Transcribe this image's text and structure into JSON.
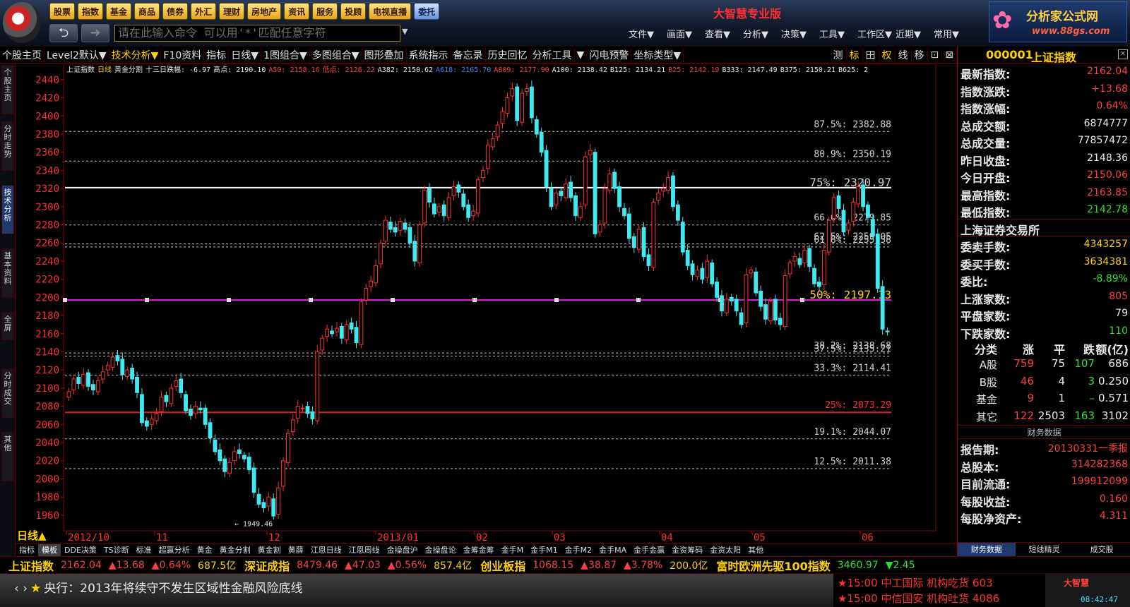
{
  "app": {
    "title": "大智慧专业版",
    "brand_name": "分析家公式网",
    "brand_url": "www.88gs.com"
  },
  "mainnav": [
    "股票",
    "指数",
    "基金",
    "商品",
    "债券",
    "外汇",
    "理财",
    "房地产",
    "资讯",
    "服务",
    "投顾",
    "电视直播",
    "委托"
  ],
  "command": {
    "placeholder": "请在此输入命令  可以用'*'匹配任意字符"
  },
  "menus": [
    "文件▼",
    "画面▼",
    "查看▼",
    "分析▼",
    "决策▼",
    "工具▼",
    "工作区▼",
    "近期▼",
    "常用▼"
  ],
  "tabs": [
    "个股主页",
    "Level2默认▼",
    "技术分析▼",
    "F10资料",
    "指标",
    "日线▼",
    "1图组合▼",
    "多图组合▼",
    "图形叠加",
    "系统指示",
    "备忘录",
    "历史回忆",
    "分析工具",
    "▼",
    "闪电预警",
    "坐标类型▼"
  ],
  "toolicons": [
    "测",
    "标",
    "田",
    "权",
    "线",
    "移",
    "⊡",
    "⊠"
  ],
  "sidebar": [
    "个股主页",
    "分时走势",
    "技术分析",
    "基本资料",
    "全屏",
    "分时成交",
    "其他"
  ],
  "chart": {
    "header": {
      "name": "上证指数",
      "period": "日线",
      "tool": "黄金分割",
      "label13": "十三日跌幅: -6.97",
      "high": "高点: 2190.10",
      "a50": "A50: 2158.16",
      "low": "低点: 2126.22",
      "a382": "A382: 2150.62",
      "a618": "A618: 2165.70",
      "a809": "A809: 2177.90",
      "a100": "A100: 2138.42",
      "b125": "B125: 2134.21",
      "b25": "B25: 2142.19",
      "b333": "B333: 2147.49",
      "b375": "B375: 2150.21",
      "b625": "B625: 2"
    },
    "period_label": "日线▲",
    "low_marker": "← 1949.46"
  },
  "chart_data": {
    "type": "candlestick",
    "title": "上证指数 日线",
    "ylim": [
      1949,
      2450
    ],
    "y_ticks": [
      1960,
      1980,
      2000,
      2020,
      2040,
      2060,
      2080,
      2100,
      2120,
      2140,
      2160,
      2180,
      2200,
      2220,
      2240,
      2260,
      2280,
      2300,
      2320,
      2340,
      2360,
      2380,
      2400,
      2420,
      2440
    ],
    "x_ticks": [
      "2012/10",
      "11",
      "12",
      "2013/01",
      "02",
      "03",
      "04",
      "05",
      "06"
    ],
    "fib_levels": [
      {
        "label": "87.5%: 2382.88",
        "value": 2382.88,
        "color": "#c0c0c0"
      },
      {
        "label": "80.9%: 2350.19",
        "value": 2350.19,
        "color": "#c0c0c0"
      },
      {
        "label": "75%: 2320.97",
        "value": 2320.97,
        "color": "#ffffff"
      },
      {
        "label": "66.6%: 2279.85",
        "value": 2279.85,
        "color": "#c0c0c0"
      },
      {
        "label": "62.5%: 2259.05",
        "value": 2259.05,
        "color": "#c0c0c0"
      },
      {
        "label": "61.8%: 2255.58",
        "value": 2255.58,
        "color": "#c0c0c0"
      },
      {
        "label": "50%: 2197.13",
        "value": 2197.13,
        "color": "#d020d0"
      },
      {
        "label": "38.2%: 2138.68",
        "value": 2138.68,
        "color": "#c0c0c0"
      },
      {
        "label": "37.5%: 2135.21",
        "value": 2135.21,
        "color": "#c0c0c0"
      },
      {
        "label": "33.3%: 2114.41",
        "value": 2114.41,
        "color": "#c0c0c0"
      },
      {
        "label": "25%: 2073.29",
        "value": 2073.29,
        "color": "#e02020"
      },
      {
        "label": "19.1%: 2044.07",
        "value": 2044.07,
        "color": "#c0c0c0"
      },
      {
        "label": "12.5%: 2011.38",
        "value": 2011.38,
        "color": "#c0c0c0"
      }
    ],
    "candles_close": [
      2096,
      2110,
      2105,
      2115,
      2102,
      2098,
      2108,
      2118,
      2125,
      2134,
      2130,
      2115,
      2120,
      2110,
      2095,
      2062,
      2058,
      2066,
      2072,
      2090,
      2085,
      2100,
      2108,
      2095,
      2075,
      2070,
      2080,
      2076,
      2060,
      2045,
      2030,
      2020,
      2008,
      2018,
      2030,
      2028,
      2022,
      2010,
      1985,
      1972,
      1968,
      1980,
      1959,
      1990,
      2020,
      2050,
      2065,
      2080,
      2078,
      2072,
      2066,
      2140,
      2155,
      2165,
      2160,
      2166,
      2155,
      2170,
      2165,
      2150,
      2195,
      2210,
      2218,
      2235,
      2260,
      2285,
      2275,
      2272,
      2284,
      2275,
      2260,
      2240,
      2280,
      2318,
      2305,
      2292,
      2300,
      2290,
      2310,
      2322,
      2316,
      2300,
      2288,
      2295,
      2330,
      2340,
      2368,
      2375,
      2390,
      2405,
      2420,
      2430,
      2395,
      2425,
      2430,
      2398,
      2380,
      2360,
      2322,
      2300,
      2315,
      2312,
      2325,
      2310,
      2290,
      2300,
      2355,
      2362,
      2270,
      2280,
      2320,
      2336,
      2320,
      2300,
      2290,
      2265,
      2255,
      2275,
      2245,
      2235,
      2305,
      2315,
      2320,
      2332,
      2300,
      2285,
      2250,
      2235,
      2225,
      2230,
      2220,
      2240,
      2215,
      2200,
      2185,
      2198,
      2196,
      2185,
      2170,
      2225,
      2230,
      2205,
      2190,
      2176,
      2196,
      2175,
      2170,
      2224,
      2238,
      2245,
      2236,
      2252,
      2234,
      2215,
      2212,
      2252,
      2285,
      2310,
      2298,
      2272,
      2282,
      2305,
      2322,
      2300,
      2288,
      2268,
      2210,
      2165,
      2162
    ]
  },
  "quote": {
    "code": "000001",
    "name": "上证指数",
    "rows1": [
      {
        "k": "最新指数:",
        "v": "2162.04",
        "c": "red"
      },
      {
        "k": "指数涨跌:",
        "v": "+13.68",
        "c": "red"
      },
      {
        "k": "指数涨幅:",
        "v": "0.64%",
        "c": "red"
      },
      {
        "k": "总成交额:",
        "v": "6874777",
        "c": "white"
      },
      {
        "k": "总成交量:",
        "v": "77857472",
        "c": "white"
      },
      {
        "k": "昨日收盘:",
        "v": "2148.36",
        "c": "white"
      },
      {
        "k": "今日开盘:",
        "v": "2150.06",
        "c": "red"
      },
      {
        "k": "最高指数:",
        "v": "2163.85",
        "c": "red"
      },
      {
        "k": "最低指数:",
        "v": "2142.78",
        "c": "green"
      }
    ],
    "exchange": "上海证券交易所",
    "rows2": [
      {
        "k": "委卖手数:",
        "v": "4343257",
        "c": "yellow"
      },
      {
        "k": "委买手数:",
        "v": "3634381",
        "c": "yellow"
      },
      {
        "k": "  委比:",
        "v": "-8.89%",
        "c": "green"
      },
      {
        "k": "上涨家数:",
        "v": "805",
        "c": "red"
      },
      {
        "k": "平盘家数:",
        "v": "79",
        "c": "white"
      },
      {
        "k": "下跌家数:",
        "v": "110",
        "c": "green"
      }
    ],
    "sector_head": [
      "分类",
      "涨",
      "平",
      "跌",
      "额(亿)"
    ],
    "sectors": [
      {
        "name": "A股",
        "up": "759",
        "flat": "75",
        "down": "107",
        "amt": "686"
      },
      {
        "name": "B股",
        "up": "46",
        "flat": "4",
        "down": "3",
        "amt": "0.250"
      },
      {
        "name": "基金",
        "up": "9",
        "flat": "1",
        "down": "–",
        "amt": "0.571"
      },
      {
        "name": "其它",
        "up": "122",
        "flat": "2503",
        "down": "163",
        "amt": "3102"
      }
    ],
    "fin_header": "财务数据",
    "fin": [
      {
        "k": "报告期:",
        "v": "20130331一季报",
        "c": "red"
      },
      {
        "k": "总股本:",
        "v": "314282368",
        "c": "red"
      },
      {
        "k": "目前流通:",
        "v": "199912099",
        "c": "red"
      },
      {
        "k": "每股收益:",
        "v": "0.160",
        "c": "red"
      },
      {
        "k": "每股净资产:",
        "v": "4.311",
        "c": "red"
      }
    ],
    "bottom_tabs": [
      "财务数据",
      "短线精灵",
      "成交股"
    ]
  },
  "bottom_tabs": [
    "指标",
    "模板",
    "DDE决策",
    "TS诊断",
    "标准",
    "超赢分析",
    "黄金",
    "黄金分割",
    "黄金割",
    "黄薛",
    "江恩日线",
    "江恩周线",
    "金操盘沪",
    "金操盘论",
    "金筹金筹",
    "金手M",
    "金手M1",
    "金手M2",
    "金手MA",
    "金手金赢",
    "金资筹码",
    "金资太阳",
    "其他"
  ],
  "ticker": [
    {
      "name": "上证指数",
      "vals": [
        {
          "t": "2162.04",
          "c": "red"
        },
        {
          "t": "▲13.68",
          "c": "red"
        },
        {
          "t": "▲0.64%",
          "c": "red"
        },
        {
          "t": "687.5亿",
          "c": "yellow"
        }
      ]
    },
    {
      "name": "深证成指",
      "vals": [
        {
          "t": "8479.46",
          "c": "red"
        },
        {
          "t": "▲47.03",
          "c": "red"
        },
        {
          "t": "▲0.56%",
          "c": "red"
        },
        {
          "t": "857.4亿",
          "c": "yellow"
        }
      ]
    },
    {
      "name": "创业板指",
      "vals": [
        {
          "t": "1068.15",
          "c": "red"
        },
        {
          "t": "▲38.87",
          "c": "red"
        },
        {
          "t": "▲3.78%",
          "c": "red"
        },
        {
          "t": "200.0亿",
          "c": "yellow"
        }
      ]
    },
    {
      "name": "富时欧洲先驱100指数",
      "vals": [
        {
          "t": "3460.97",
          "c": "green"
        },
        {
          "t": "▼2.45",
          "c": "green"
        }
      ]
    }
  ],
  "news": "央行：2013年将续守不发生区域性金融风险底线",
  "alerts": [
    "★15:00 中工国际 机构吃货 603",
    "★15:00 中信国安 机构吐货 4086"
  ],
  "clock": {
    "logo": "大智慧",
    "time": "08:42:47"
  }
}
